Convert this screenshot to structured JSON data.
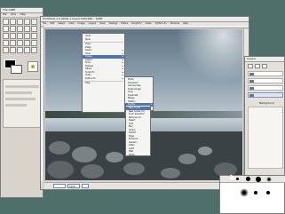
{
  "toolbox": {
    "title": "The GIMP",
    "menu": [
      "File",
      "Xtns",
      "Help"
    ]
  },
  "image_window": {
    "title": "[Untitled]-1.0 (RGB, 1 layer) 640x480 – GIMP",
    "menu": [
      "File",
      "Edit",
      "Select",
      "View",
      "Image",
      "Layers",
      "Tools",
      "Dialogs",
      "Filters",
      "Script-Fu",
      "Video",
      "Python-Fu",
      "Window",
      "Help"
    ],
    "zoom": "100%"
  },
  "context_menu": {
    "items": [
      "Undo",
      "Redo",
      "Copy",
      "Paste",
      "Select",
      "View",
      "Image",
      "Layers",
      "Tools",
      "Dialogs",
      "Filters",
      "Script-Fu",
      "Video",
      "Python-Fu",
      "Help"
    ],
    "highlighted_index": 6
  },
  "submenu1": {
    "items": [
      "Mode",
      "Transform",
      "Canvas Size",
      "Scale Image",
      "Crop",
      "Duplicate",
      "Merge",
      "Flatten",
      "Guides",
      "Flip"
    ],
    "highlighted_index": 8
  },
  "submenu2": {
    "items": [
      "New Guide",
      "New Guide (%)",
      "From Selection",
      "Remove All",
      "Select",
      "Grid",
      "Blur",
      "Colors",
      "Distort",
      "Edge",
      "Enhance",
      "Generic",
      "Glass",
      "Light",
      "Map",
      "Noise"
    ],
    "highlighted_index": 0
  },
  "layers_dock": {
    "title": "Layers",
    "tab": "Background"
  },
  "colors": {
    "desktop": "#4f6f6b",
    "highlight": "#4d74b8",
    "window": "#d8d4cc"
  }
}
